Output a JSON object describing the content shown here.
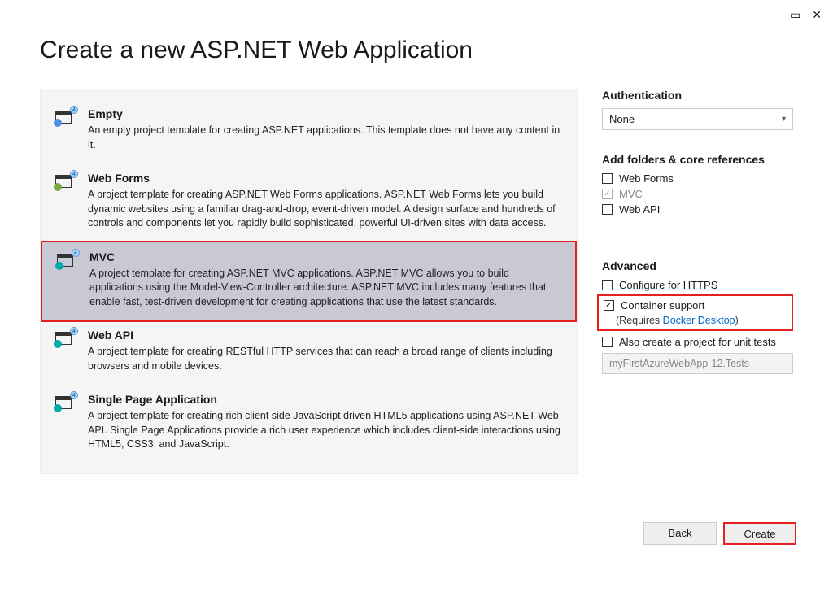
{
  "window": {
    "title": "Create a new ASP.NET Web Application"
  },
  "templates": [
    {
      "name": "Empty",
      "desc": "An empty project template for creating ASP.NET applications. This template does not have any content in it.",
      "selected": false,
      "sub": "globe"
    },
    {
      "name": "Web Forms",
      "desc": "A project template for creating ASP.NET Web Forms applications. ASP.NET Web Forms lets you build dynamic websites using a familiar drag-and-drop, event-driven model. A design surface and hundreds of controls and components let you rapidly build sophisticated, powerful UI-driven sites with data access.",
      "selected": false,
      "sub": "cs"
    },
    {
      "name": "MVC",
      "desc": "A project template for creating ASP.NET MVC applications. ASP.NET MVC allows you to build applications using the Model-View-Controller architecture. ASP.NET MVC includes many features that enable fast, test-driven development for creating applications that use the latest standards.",
      "selected": true,
      "sub": "mvc"
    },
    {
      "name": "Web API",
      "desc": "A project template for creating RESTful HTTP services that can reach a broad range of clients including browsers and mobile devices.",
      "selected": false,
      "sub": "mvc"
    },
    {
      "name": "Single Page Application",
      "desc": "A project template for creating rich client side JavaScript driven HTML5 applications using ASP.NET Web API. Single Page Applications provide a rich user experience which includes client-side interactions using HTML5, CSS3, and JavaScript.",
      "selected": false,
      "sub": "mvc"
    }
  ],
  "auth": {
    "heading": "Authentication",
    "value": "None"
  },
  "folders": {
    "heading": "Add folders & core references",
    "items": [
      {
        "label": "Web Forms",
        "checked": false,
        "disabled": false
      },
      {
        "label": "MVC",
        "checked": true,
        "disabled": true
      },
      {
        "label": "Web API",
        "checked": false,
        "disabled": false
      }
    ]
  },
  "advanced": {
    "heading": "Advanced",
    "https": {
      "label": "Configure for HTTPS",
      "checked": false
    },
    "container": {
      "label": "Container support",
      "checked": true,
      "requires_prefix": "(Requires ",
      "requires_link": "Docker Desktop",
      "requires_suffix": ")"
    },
    "unit_tests": {
      "label": "Also create a project for unit tests",
      "checked": false
    },
    "test_project_name": "myFirstAzureWebApp-12.Tests"
  },
  "buttons": {
    "back": "Back",
    "create": "Create"
  }
}
